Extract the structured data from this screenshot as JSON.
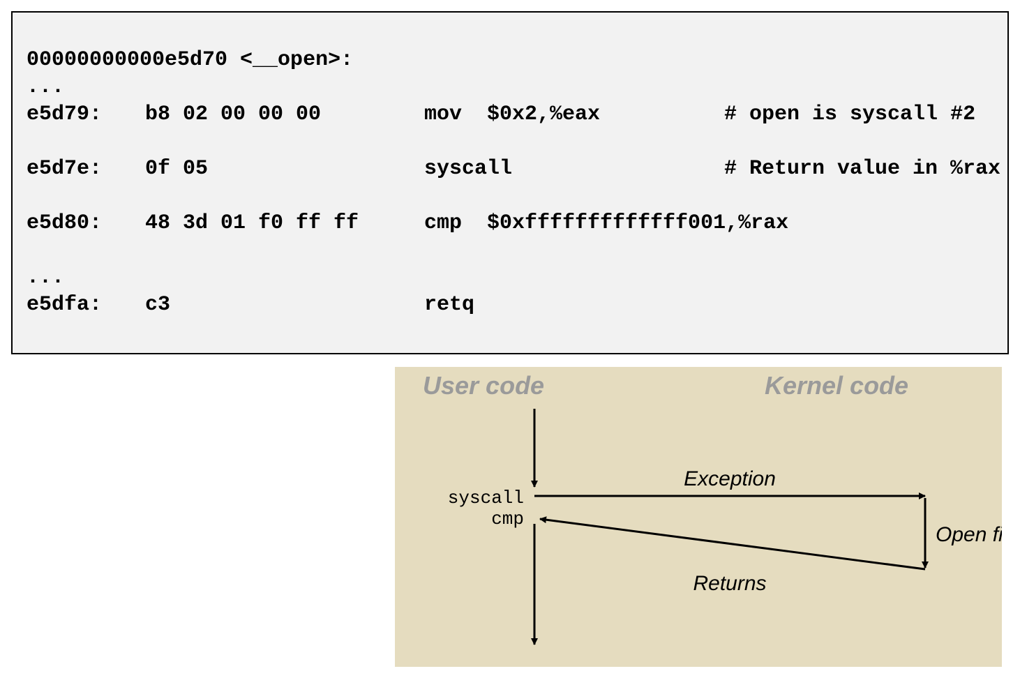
{
  "code": {
    "header": "00000000000e5d70 <__open>:",
    "ell1": "...",
    "r1_addr": "e5d79:",
    "r1_bytes": "b8 02 00 00 00",
    "r1_instr": "mov  $0x2,%eax",
    "r1_comment_prefix": "# ",
    "r1_comment_mono": "open",
    "r1_comment_suffix": " is syscall #2",
    "r2_addr": "e5d7e:",
    "r2_bytes": "0f 05",
    "r2_instr": "syscall",
    "r2_comment": "# Return value in %rax",
    "r3_addr": "e5d80:",
    "r3_bytes": "48 3d 01 f0 ff ff",
    "r3_instr": "cmp  $0xfffffffffffff001,%rax",
    "ell2": "...",
    "r4_addr": "e5dfa:",
    "r4_bytes": "c3",
    "r4_instr": "retq"
  },
  "diagram": {
    "user_title": "User code",
    "kernel_title": "Kernel code",
    "syscall_label": "syscall",
    "cmp_label": "cmp",
    "exception_label": "Exception",
    "returns_label": "Returns",
    "open_file_label": "Open file"
  }
}
